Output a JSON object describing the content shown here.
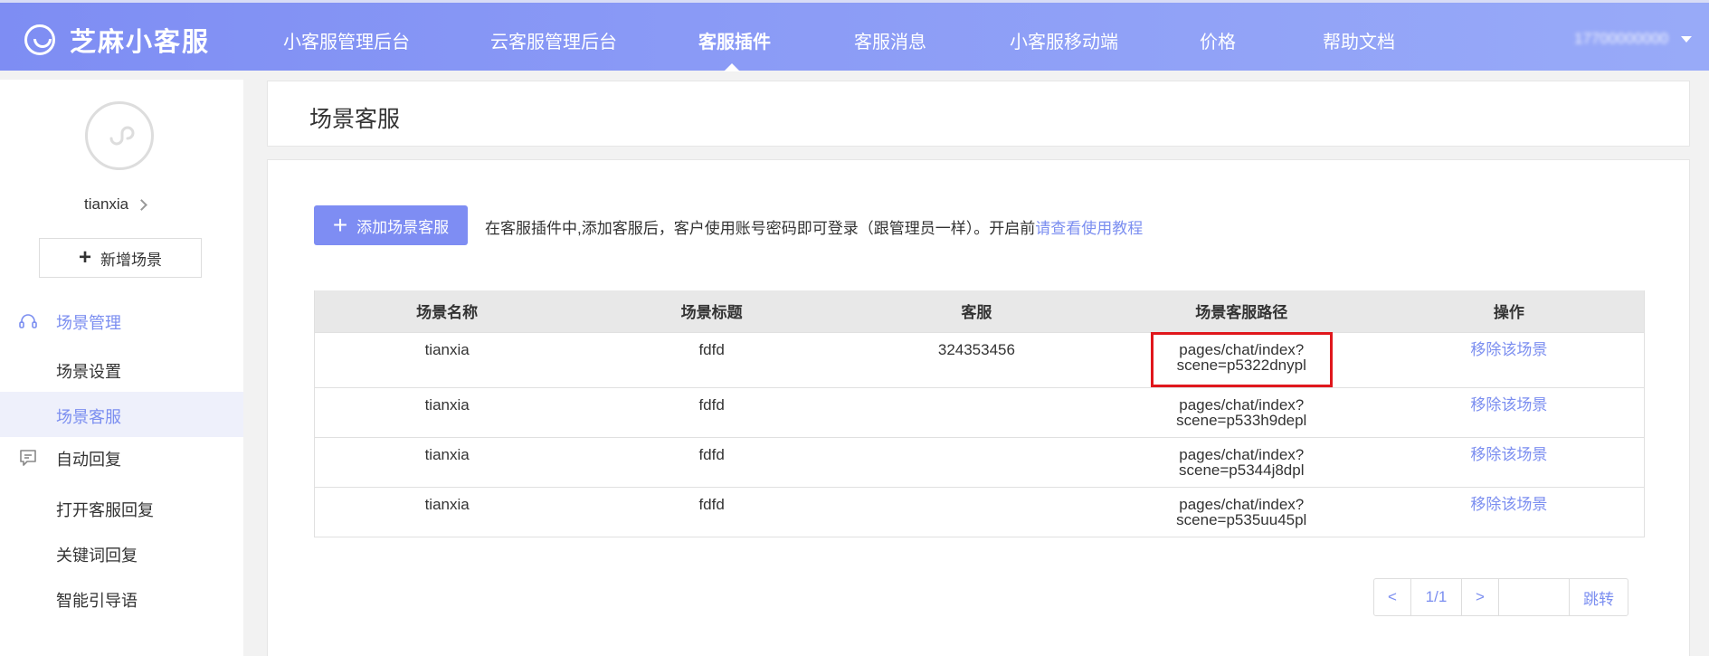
{
  "header": {
    "brand": "芝麻小客服",
    "nav": [
      {
        "label": "小客服管理后台"
      },
      {
        "label": "云客服管理后台"
      },
      {
        "label": "客服插件"
      },
      {
        "label": "客服消息"
      },
      {
        "label": "小客服移动端"
      },
      {
        "label": "价格"
      },
      {
        "label": "帮助文档"
      }
    ],
    "active_nav": "客服插件",
    "account": "17700000000"
  },
  "sidebar": {
    "username": "tianxia",
    "add_scene_label": "新增场景",
    "group1_label": "场景管理",
    "group1_items": [
      {
        "label": "场景设置"
      },
      {
        "label": "场景客服"
      }
    ],
    "group2_label": "自动回复",
    "group2_items": [
      {
        "label": "打开客服回复"
      },
      {
        "label": "关键词回复"
      },
      {
        "label": "智能引导语"
      }
    ]
  },
  "page": {
    "title": "场景客服",
    "add_button": "添加场景客服",
    "hint_text": "在客服插件中,添加客服后，客户使用账号密码即可登录（跟管理员一样）。开启前",
    "hint_link": "请查看使用教程"
  },
  "table": {
    "columns": [
      "场景名称",
      "场景标题",
      "客服",
      "场景客服路径",
      "操作"
    ],
    "rows": [
      {
        "name": "tianxia",
        "title": "fdfd",
        "agent": "324353456",
        "path1": "pages/chat/index?",
        "path2": "scene=p5322dnypl",
        "action": "移除该场景"
      },
      {
        "name": "tianxia",
        "title": "fdfd",
        "agent": "",
        "path1": "pages/chat/index?",
        "path2": "scene=p533h9depl",
        "action": "移除该场景"
      },
      {
        "name": "tianxia",
        "title": "fdfd",
        "agent": "",
        "path1": "pages/chat/index?",
        "path2": "scene=p5344j8dpl",
        "action": "移除该场景"
      },
      {
        "name": "tianxia",
        "title": "fdfd",
        "agent": "",
        "path1": "pages/chat/index?",
        "path2": "scene=p535uu45pl",
        "action": "移除该场景"
      }
    ]
  },
  "pager": {
    "prev": "<",
    "page": "1/1",
    "next": ">",
    "jump_value": "",
    "jump": "跳转"
  },
  "colors": {
    "accent": "#7e8df3",
    "link": "#7b8ef0",
    "highlight": "#e0171c"
  }
}
